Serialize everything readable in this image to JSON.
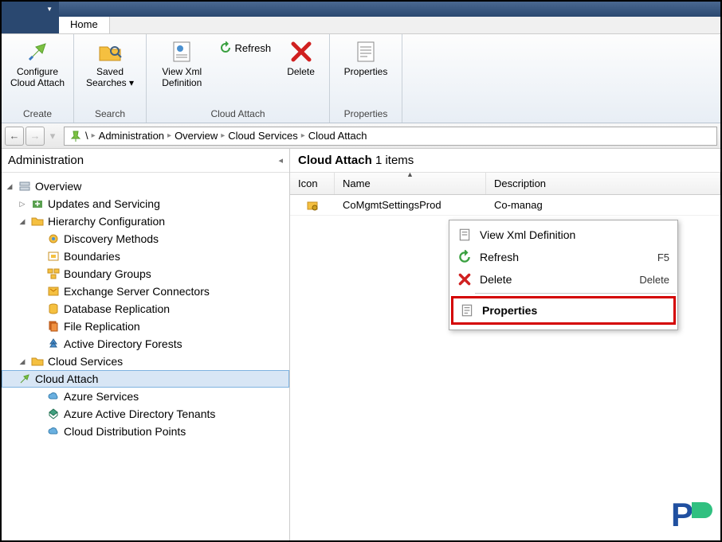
{
  "tab": {
    "home": "Home"
  },
  "ribbon": {
    "create": {
      "label": "Create",
      "configure_cloud_attach": "Configure\nCloud Attach"
    },
    "search": {
      "label": "Search",
      "saved_searches": "Saved\nSearches ▾"
    },
    "cloud_attach": {
      "label": "Cloud Attach",
      "view_xml": "View Xml\nDefinition",
      "refresh": "Refresh",
      "delete": "Delete"
    },
    "properties_group": {
      "label": "Properties",
      "properties": "Properties"
    }
  },
  "breadcrumb": {
    "items": [
      "Administration",
      "Overview",
      "Cloud Services",
      "Cloud Attach"
    ]
  },
  "tree": {
    "title": "Administration",
    "overview": "Overview",
    "updates": "Updates and Servicing",
    "hierarchy": "Hierarchy Configuration",
    "discovery": "Discovery Methods",
    "boundaries": "Boundaries",
    "boundary_groups": "Boundary Groups",
    "exchange": "Exchange Server Connectors",
    "db_repl": "Database Replication",
    "file_repl": "File Replication",
    "ad_forests": "Active Directory Forests",
    "cloud_services": "Cloud Services",
    "cloud_attach": "Cloud Attach",
    "azure_services": "Azure Services",
    "aad_tenants": "Azure Active Directory Tenants",
    "cloud_dist": "Cloud Distribution Points"
  },
  "main": {
    "title_prefix": "Cloud Attach",
    "title_count": "1 items",
    "columns": {
      "icon": "Icon",
      "name": "Name",
      "desc": "Description"
    },
    "row": {
      "name": "CoMgmtSettingsProd",
      "desc": "Co-manag"
    }
  },
  "ctx": {
    "view_xml": "View Xml Definition",
    "refresh": "Refresh",
    "refresh_key": "F5",
    "delete": "Delete",
    "delete_key": "Delete",
    "properties": "Properties"
  }
}
